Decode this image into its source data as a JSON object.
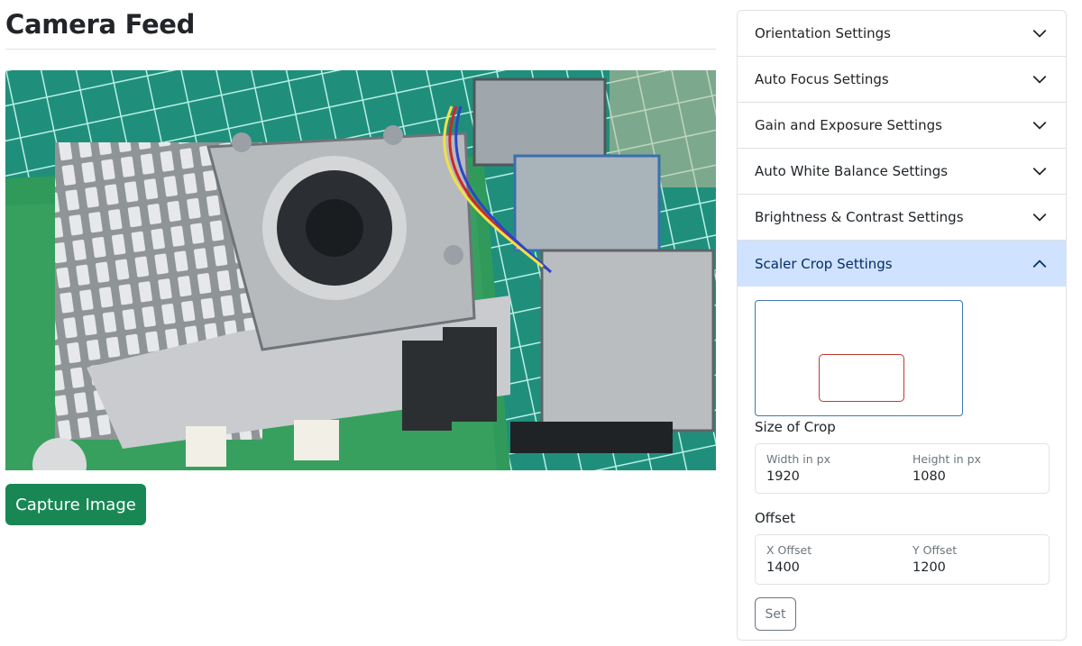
{
  "page": {
    "title": "Camera Feed"
  },
  "camera": {
    "alt": "Camera feed",
    "capture_label": "Capture Image"
  },
  "settings": {
    "sections": [
      {
        "label": "Orientation Settings",
        "expanded": false
      },
      {
        "label": "Auto Focus Settings",
        "expanded": false
      },
      {
        "label": "Gain and Exposure Settings",
        "expanded": false
      },
      {
        "label": "Auto White Balance Settings",
        "expanded": false
      },
      {
        "label": "Brightness & Contrast Settings",
        "expanded": false
      },
      {
        "label": "Scaler Crop Settings",
        "expanded": true
      }
    ],
    "scaler_crop": {
      "size_label": "Size of Crop",
      "width_label": "Width in px",
      "width_value": "1920",
      "height_label": "Height in px",
      "height_value": "1080",
      "offset_label": "Offset",
      "x_offset_label": "X Offset",
      "x_offset_value": "1400",
      "y_offset_label": "Y Offset",
      "y_offset_value": "1200",
      "set_label": "Set"
    }
  },
  "colors": {
    "primary_success": "#198754",
    "active_header": "#cfe2ff",
    "crop_outline": "#3d78b5",
    "crop_region": "#c0392b"
  }
}
